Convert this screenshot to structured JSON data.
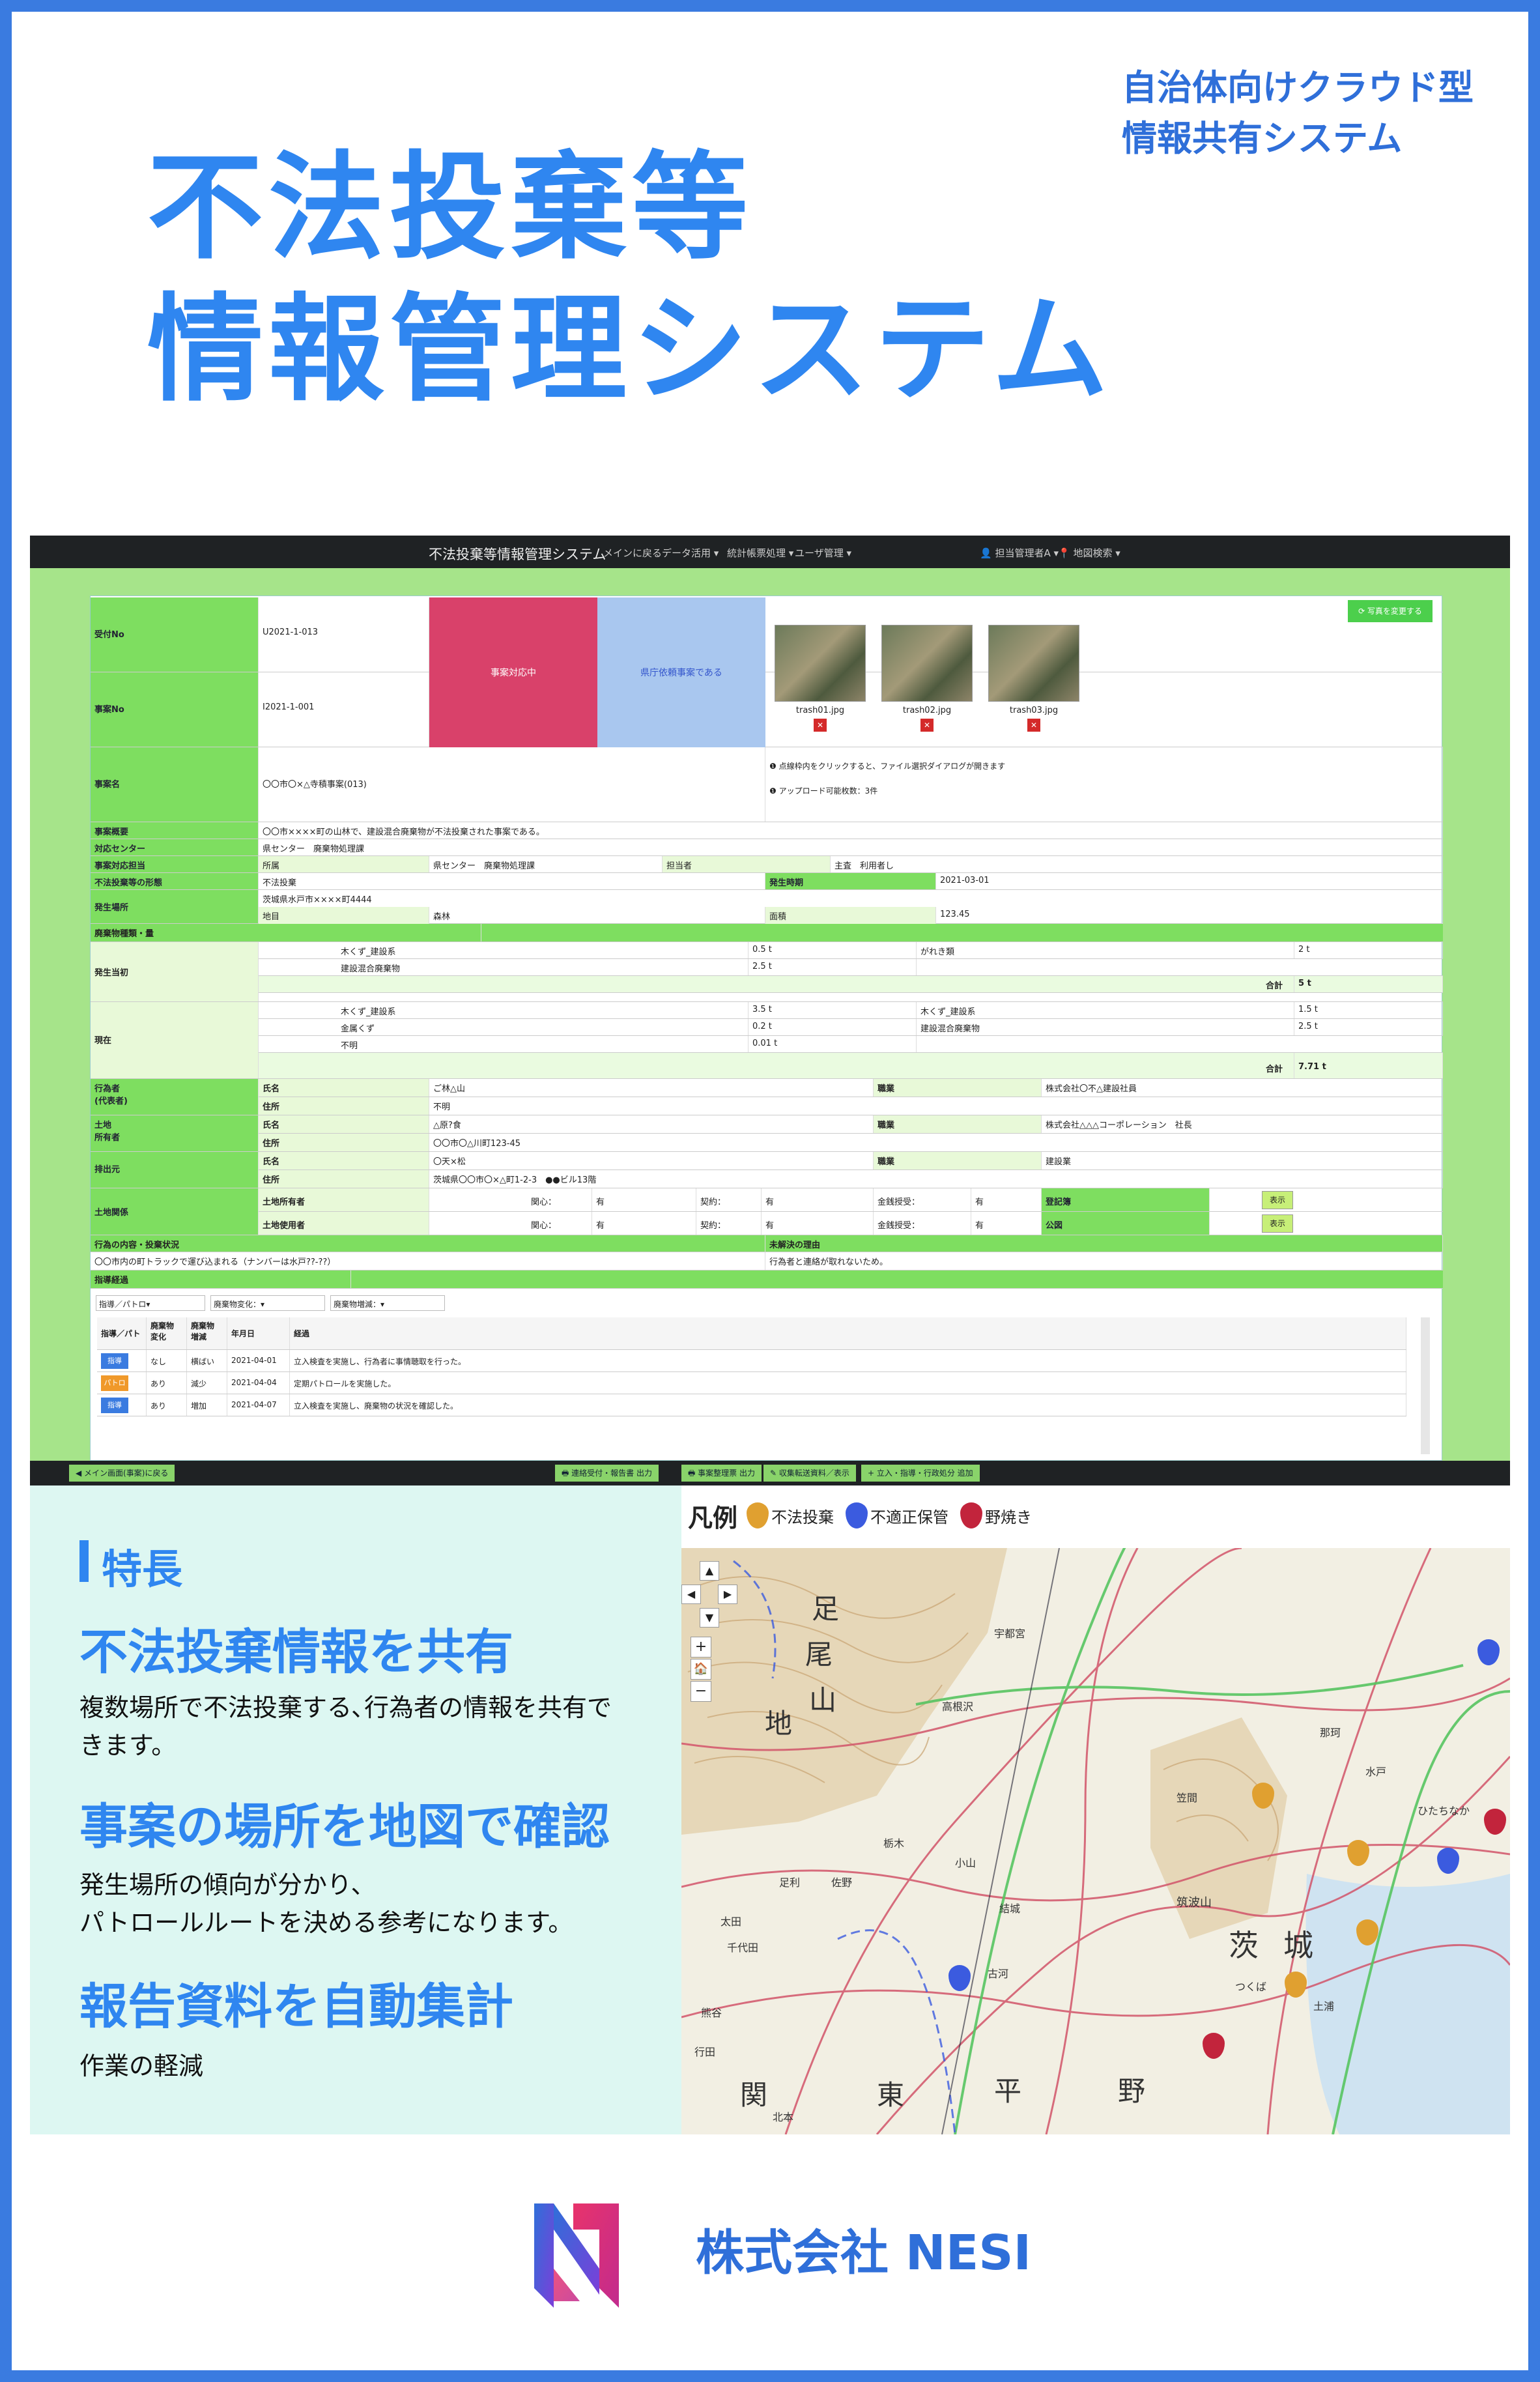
{
  "header": {
    "subtitle": "自治体向けクラウド型\n情報共有システム",
    "title": "不法投棄等\n情報管理システム"
  },
  "app": {
    "window_title": "不法投棄等情報管理システム",
    "nav": [
      "メインに戻る",
      "データ活用 ▾",
      "統計帳票処理 ▾",
      "ユーザ管理 ▾"
    ],
    "user": "👤 担当管理者A ▾",
    "location": "📍 地図検索 ▾",
    "photo_change_button": "⟳ 写真を変更する",
    "case": {
      "reception_no_label": "受付No",
      "reception_no": "U2021-1-013",
      "case_no_label": "事案No",
      "case_no": "I2021-1-001",
      "status_pink": "事案対応中",
      "status_blue": "県庁依頼事案である",
      "case_name_label": "事案名",
      "case_name": "〇〇市〇×△寺積事案(013)",
      "photos": [
        "trash01.jpg",
        "trash02.jpg",
        "trash03.jpg"
      ],
      "photo_note1": "❶ 点線枠内をクリックすると、ファイル選択ダイアログが開きます",
      "photo_note2": "❶ アップロード可能枚数：3件",
      "overview_label": "事案概要",
      "overview": "〇〇市××××町の山林で、建設混合廃棄物が不法投棄された事案である。",
      "center_label": "対応センター",
      "center": "県センター　廃棄物処理課",
      "dept_label": "事案対応担当",
      "dept_sub": "所属",
      "dept": "県センター　廃棄物処理課",
      "person_label": "担当者",
      "person": "主査　利用者し",
      "found_label": "不法投棄等の形態",
      "found": "不法投棄",
      "time_label": "発生時期",
      "time": "2021-03-01",
      "place_label": "発生場所",
      "place": "茨城県水戸市××××町4444",
      "land_label": "地目",
      "land": "森林",
      "area_label": "面積",
      "area": "123.45",
      "waste_header": "廃棄物種類・量",
      "gen_label": "発生当初",
      "gen_items": [
        {
          "name": "木くず_建設系",
          "amount": "0.5 t",
          "name2": "がれき類",
          "amount2": "2 t"
        },
        {
          "name": "建設混合廃棄物",
          "amount": "2.5 t",
          "name2": "",
          "amount2": ""
        }
      ],
      "gen_total_label": "合計",
      "gen_total": "5 t",
      "now_label": "現在",
      "now_items": [
        {
          "name": "木くず_建設系",
          "amount": "3.5 t",
          "name2": "木くず_建設系",
          "amount2": "1.5 t"
        },
        {
          "name": "金属くず",
          "amount": "0.2 t",
          "name2": "建設混合廃棄物",
          "amount2": "2.5 t"
        },
        {
          "name": "不明",
          "amount": "0.01 t",
          "name2": "",
          "amount2": ""
        }
      ],
      "now_total_label": "合計",
      "now_total": "7.71 t",
      "actor_label": "行為者\n(代表者)",
      "actor_name_label": "氏名",
      "actor_name": "ご林△山",
      "actor_addr_label": "住所",
      "actor_addr": "不明",
      "actor_job_label": "職業",
      "actor_job": "株式会社〇不△建設社員",
      "owner_label": "土地\n所有者",
      "owner_name": "△原?食",
      "owner_addr": "〇〇市〇△川町123-45",
      "owner_job": "株式会社△△△コーポレーション　社長",
      "dest_label": "排出元",
      "dest_name": "〇天×松",
      "dest_addr": "茨城県〇〇市〇×△町1-2-3　●●ビル13階",
      "dest_job": "建設業",
      "rel_label": "土地関係",
      "rel_owner": "土地所有者",
      "rel_user": "土地使用者",
      "rel_kankin": "関心：",
      "rel_yes": "有",
      "rel_keiyaku": "契約：",
      "rel_money": "金銭授受：",
      "rel_reg": "登記簿",
      "rel_pub": "公図",
      "view": "表示",
      "content_label": "行為の内容・投棄状況",
      "content": "〇〇市内の町トラックで運び込まれる（ナンバーは水戸??-??）",
      "judge_label": "未解決の理由",
      "judge": "行為者と連絡が取れないため。",
      "history_label": "指導経過",
      "filters": [
        "指導／パトロ▾",
        "廃棄物変化：▾",
        "廃棄物増減：▾"
      ],
      "history_cols": [
        "指導／パト",
        "廃棄物\n変化",
        "廃棄物\n増減",
        "年月日",
        "経過"
      ],
      "history": [
        {
          "btn": "指導",
          "change": "なし",
          "trend": "横ばい",
          "date": "2021-04-01",
          "note": "立入検査を実施し、行為者に事情聴取を行った。"
        },
        {
          "btn": "パトロ",
          "change": "あり",
          "trend": "減少",
          "date": "2021-04-04",
          "note": "定期パトロールを実施した。"
        },
        {
          "btn": "指導",
          "change": "あり",
          "trend": "増加",
          "date": "2021-04-07",
          "note": "立入検査を実施し、廃棄物の状況を確認した。"
        }
      ]
    },
    "bottom_buttons": [
      "◀ メイン画面(事案)に戻る",
      "🖶 連絡受付・報告書 出力",
      "🖶 事案整理票 出力",
      "✎ 収集転送資料／表示",
      "+ 立入・指導・行政処分 追加"
    ]
  },
  "features": {
    "heading": "特長",
    "items": [
      {
        "title": "不法投棄情報を共有",
        "desc": "複数場所で不法投棄する､行為者の情報を共有で\nきます。"
      },
      {
        "title": "事案の場所を地図で確認",
        "desc": "発生場所の傾向が分かり、\nパトロールルートを決める参考になります。"
      },
      {
        "title": "報告資料を自動集計",
        "desc": "作業の軽減"
      }
    ]
  },
  "map": {
    "legend_title": "凡例",
    "legend": [
      {
        "label": "不法投棄",
        "color": "#e0a030"
      },
      {
        "label": "不適正保管",
        "color": "#3b5bdf"
      },
      {
        "label": "野焼き",
        "color": "#c2243c"
      }
    ],
    "labels": [
      "足",
      "尾",
      "山",
      "地",
      "茨",
      "城",
      "関",
      "東",
      "平",
      "野",
      "筑波山",
      "宇都宮",
      "栃木",
      "水戸",
      "ひたちなか",
      "高根沢",
      "那珂",
      "笠間",
      "土浦",
      "つくば",
      "小山",
      "結城",
      "古河",
      "佐野",
      "足利",
      "太田",
      "千代田",
      "熊谷",
      "北本",
      "行田"
    ],
    "controls": [
      "▲",
      "◀",
      "▶",
      "▼",
      "+",
      "🏠",
      "−"
    ]
  },
  "footer": {
    "company": "株式会社 NESI"
  }
}
